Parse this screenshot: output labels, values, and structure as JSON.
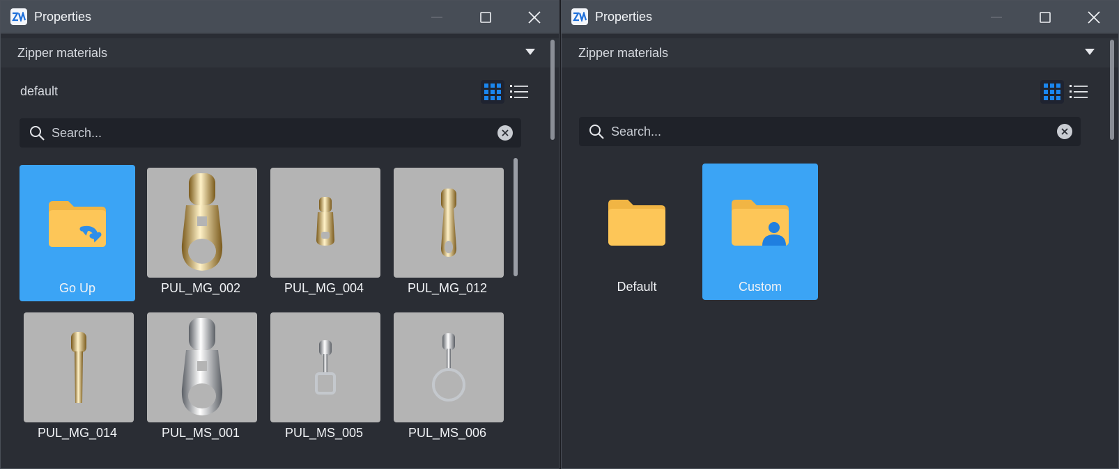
{
  "left": {
    "title": "Properties",
    "section": "Zipper materials",
    "path_label": "default",
    "search_placeholder": "Search...",
    "items": [
      {
        "label": "Go Up",
        "type": "folder-up",
        "selected": true
      },
      {
        "label": "PUL_MG_002",
        "type": "thumb",
        "color": "gold",
        "shape": "wide-ring"
      },
      {
        "label": "PUL_MG_004",
        "type": "thumb",
        "color": "gold",
        "shape": "small"
      },
      {
        "label": "PUL_MG_012",
        "type": "thumb",
        "color": "gold",
        "shape": "slim-ring"
      },
      {
        "label": "PUL_MG_014",
        "type": "thumb",
        "color": "gold",
        "shape": "bar"
      },
      {
        "label": "PUL_MS_001",
        "type": "thumb",
        "color": "silver",
        "shape": "wide-ring"
      },
      {
        "label": "PUL_MS_005",
        "type": "thumb",
        "color": "silver",
        "shape": "rect-loop"
      },
      {
        "label": "PUL_MS_006",
        "type": "thumb",
        "color": "silver",
        "shape": "round-loop"
      }
    ]
  },
  "right": {
    "title": "Properties",
    "section": "Zipper materials",
    "search_placeholder": "Search...",
    "items": [
      {
        "label": "Default",
        "type": "folder",
        "selected": false
      },
      {
        "label": "Custom",
        "type": "folder-user",
        "selected": true
      }
    ]
  },
  "colors": {
    "accent": "#3ba4f5",
    "folder": "#fdc658",
    "titlebar": "#474d56",
    "panel": "#2a2d34"
  }
}
